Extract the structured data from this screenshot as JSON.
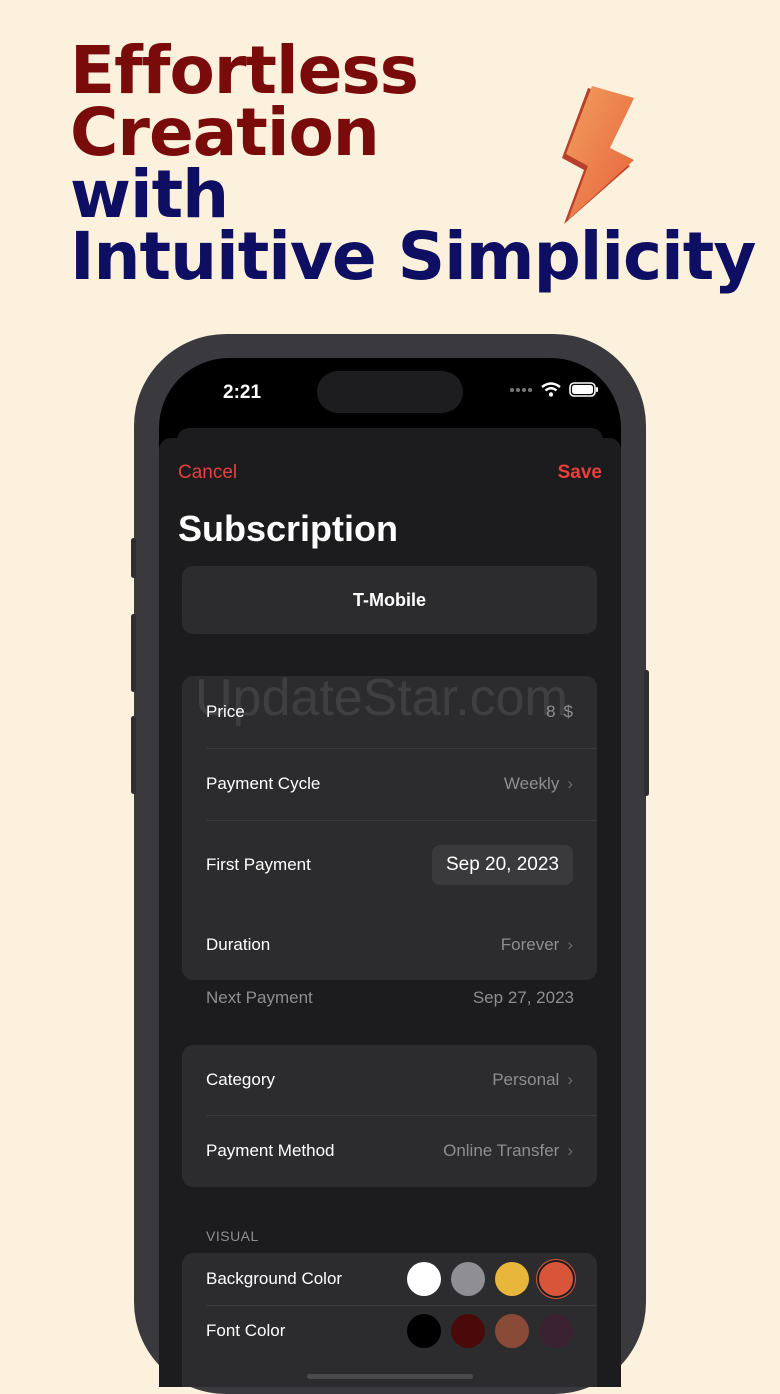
{
  "headline": {
    "line1": "Effortless",
    "line2": "Creation",
    "line3": "with",
    "line4": "Intuitive Simplicity"
  },
  "status_bar": {
    "time": "2:21"
  },
  "nav": {
    "cancel_label": "Cancel",
    "save_label": "Save"
  },
  "page_title": "Subscription",
  "subscription_name": "T-Mobile",
  "pricing": {
    "price_label": "Price",
    "price_value": "8",
    "currency": "$",
    "cycle_label": "Payment Cycle",
    "cycle_value": "Weekly",
    "first_payment_label": "First Payment",
    "first_payment_value": "Sep 20, 2023",
    "duration_label": "Duration",
    "duration_value": "Forever"
  },
  "next_payment": {
    "label": "Next Payment",
    "value": "Sep 27, 2023"
  },
  "details": {
    "category_label": "Category",
    "category_value": "Personal",
    "method_label": "Payment Method",
    "method_value": "Online Transfer"
  },
  "visual": {
    "section_label": "VISUAL",
    "background_color_label": "Background Color",
    "font_color_label": "Font Color",
    "background_swatches": [
      "#ffffff",
      "#8e8e93",
      "#e8b63a",
      "#d9553a"
    ],
    "font_swatches": [
      "#000000",
      "#4a0a0a",
      "#8a4a38",
      "#3a2233"
    ]
  },
  "watermark": "UpdateStar.com",
  "colors": {
    "accent": "#e8403e",
    "headline_maroon": "#7a0b0b",
    "headline_navy": "#0e0e63"
  }
}
